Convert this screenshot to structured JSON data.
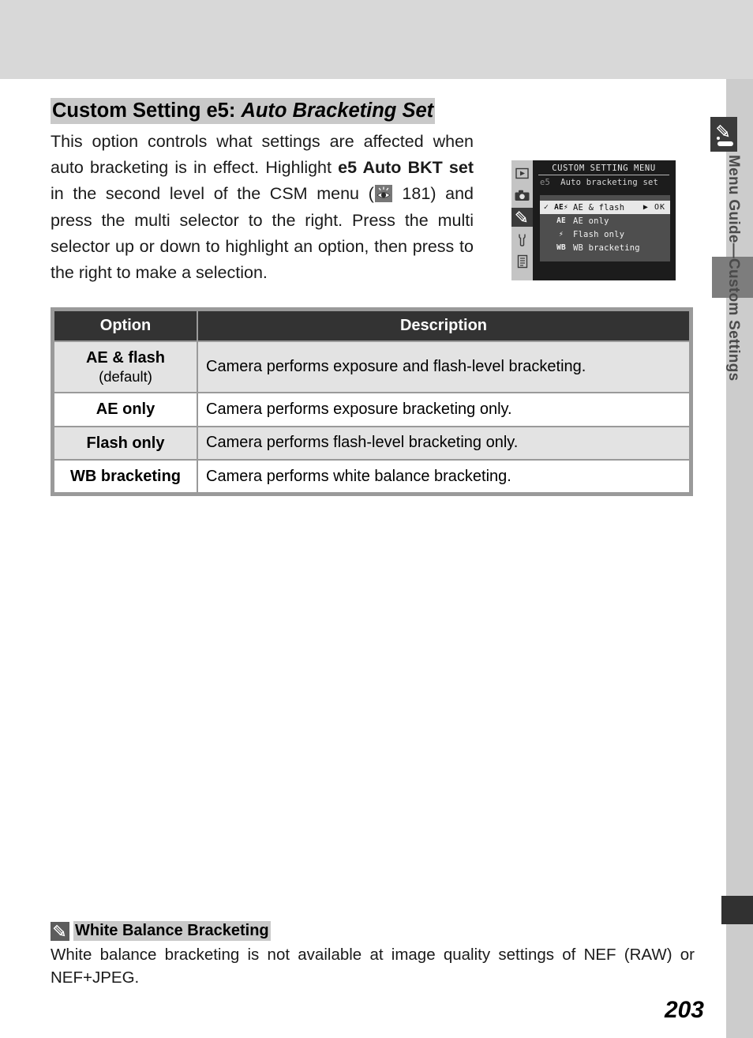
{
  "page": {
    "number": "203",
    "sidebar_label": "Menu Guide—Custom Settings",
    "sidebar_icon": "pencil-icon"
  },
  "heading": {
    "prefix": "Custom Setting e5: ",
    "italic": "Auto Bracketing Set"
  },
  "intro": {
    "part1": "This option controls what settings are affected when auto bracketing is in effect.  Highlight ",
    "bold1": "e5 Auto BKT set",
    "part2": " in the second level of the CSM menu (",
    "ref_icon": "eye-reference-icon",
    "ref_page": " 181",
    "part3": ") and press the multi selector to the right.  Press the multi selector up or down to highlight an option, then press to the right to make a selection."
  },
  "lcd": {
    "rail_icons": [
      "playback-icon",
      "camera-icon",
      "pencil-icon",
      "wrench-icon",
      "list-icon"
    ],
    "active_rail_index": 2,
    "title": "CUSTOM SETTING MENU",
    "item_number": "e5",
    "item_name": "Auto bracketing set",
    "ok_label": "OK",
    "rows": [
      {
        "check": "✓",
        "symbol": "AE⚡",
        "label": "AE & flash",
        "selected": true
      },
      {
        "check": "",
        "symbol": "AE",
        "label": "AE only",
        "selected": false
      },
      {
        "check": "",
        "symbol": "⚡",
        "label": "Flash only",
        "selected": false
      },
      {
        "check": "",
        "symbol": "WB",
        "label": "WB bracketing",
        "selected": false
      }
    ]
  },
  "table": {
    "headers": {
      "option": "Option",
      "description": "Description"
    },
    "rows": [
      {
        "option": "AE & flash",
        "option_note": "(default)",
        "description": "Camera performs exposure and flash-level bracketing.",
        "shaded": true
      },
      {
        "option": "AE only",
        "option_note": "",
        "description": "Camera performs exposure bracketing only.",
        "shaded": false
      },
      {
        "option": "Flash only",
        "option_note": "",
        "description": "Camera performs flash-level bracketing only.",
        "shaded": true
      },
      {
        "option": "WB bracketing",
        "option_note": "",
        "description": "Camera performs white balance bracketing.",
        "shaded": false
      }
    ]
  },
  "note": {
    "icon": "pencil-icon",
    "title": "White Balance Bracketing",
    "body": "White balance bracketing is not available at image quality settings of NEF (RAW) or NEF+JPEG."
  },
  "colors": {
    "top_band": "#d8d8d8",
    "sidebar": "#cccccc",
    "highlight": "#c9c9c9",
    "table_header": "#333333",
    "row_shade": "#e3e3e3",
    "lcd_bg": "#1c1c1c"
  }
}
